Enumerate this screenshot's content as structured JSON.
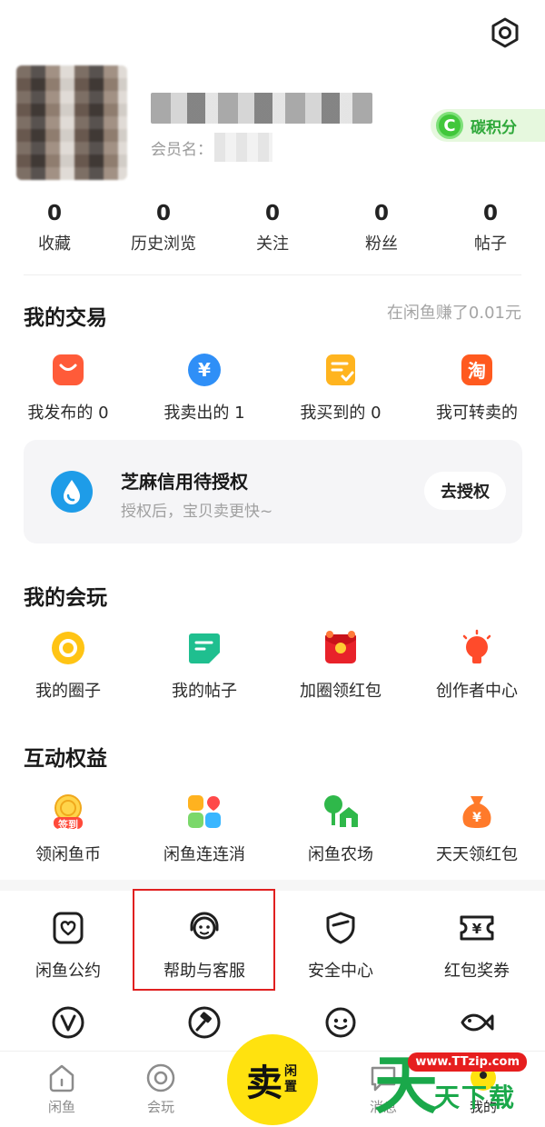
{
  "profile": {
    "member_label": "会员名：",
    "carbon_icon_letter": "C",
    "carbon_label": "碳积分"
  },
  "stats": [
    {
      "num": "0",
      "label": "收藏"
    },
    {
      "num": "0",
      "label": "历史浏览"
    },
    {
      "num": "0",
      "label": "关注"
    },
    {
      "num": "0",
      "label": "粉丝"
    },
    {
      "num": "0",
      "label": "帖子"
    }
  ],
  "trade": {
    "title": "我的交易",
    "earned": "在闲鱼赚了0.01元",
    "items": [
      {
        "label": "我发布的 0",
        "icon": "bag-icon"
      },
      {
        "label": "我卖出的 1",
        "icon": "yuan-coin-icon"
      },
      {
        "label": "我买到的 0",
        "icon": "checklist-icon"
      },
      {
        "label": "我可转卖的",
        "icon": "taobao-icon"
      }
    ],
    "zhima": {
      "title": "芝麻信用待授权",
      "subtitle": "授权后，宝贝卖更快~",
      "button": "去授权"
    }
  },
  "play": {
    "title": "我的会玩",
    "items": [
      {
        "label": "我的圈子",
        "icon": "circle-icon"
      },
      {
        "label": "我的帖子",
        "icon": "post-icon"
      },
      {
        "label": "加圈领红包",
        "icon": "red-envelope-icon"
      },
      {
        "label": "创作者中心",
        "icon": "lightbulb-icon"
      }
    ]
  },
  "rights": {
    "title": "互动权益",
    "items": [
      {
        "label": "领闲鱼币",
        "icon": "sign-in-coin-icon",
        "badge": "签到"
      },
      {
        "label": "闲鱼连连消",
        "icon": "match-game-icon"
      },
      {
        "label": "闲鱼农场",
        "icon": "farm-icon"
      },
      {
        "label": "天天领红包",
        "icon": "money-bag-icon"
      }
    ]
  },
  "services": {
    "items": [
      {
        "label": "闲鱼公约",
        "icon": "convention-icon"
      },
      {
        "label": "帮助与客服",
        "icon": "customer-service-icon"
      },
      {
        "label": "安全中心",
        "icon": "shield-icon"
      },
      {
        "label": "红包奖券",
        "icon": "voucher-icon"
      }
    ],
    "row2_icons": [
      "v-badge-icon",
      "auction-icon",
      "monkey-icon",
      "fish-icon"
    ]
  },
  "tabbar": {
    "items": [
      {
        "label": "闲鱼",
        "icon": "home-icon"
      },
      {
        "label": "会玩",
        "icon": "circle-tab-icon"
      },
      {
        "label": "消息",
        "icon": "message-icon"
      },
      {
        "label": "我的",
        "icon": "profile-icon"
      }
    ],
    "sell_big": "卖",
    "sell_small": "闲置"
  },
  "watermark": {
    "url": "www.TTzip.com",
    "big": "天",
    "chars": "天下载"
  },
  "colors": {
    "brand_yellow": "#ffe20f",
    "highlight_red": "#e02020",
    "carbon_green": "#41c73b"
  }
}
